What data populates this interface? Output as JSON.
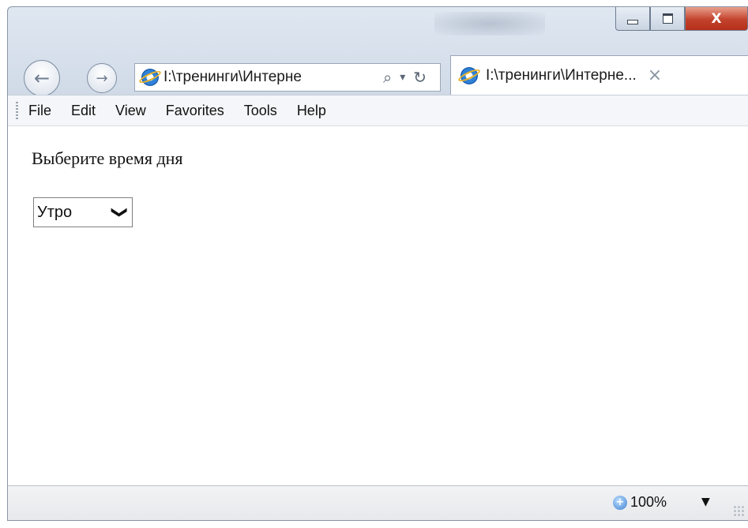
{
  "window": {
    "controls": [
      "minimize",
      "maximize",
      "close"
    ],
    "close_glyph": "X"
  },
  "navigation": {
    "back_icon": "←",
    "forward_icon": "→",
    "address": "I:\\тренинги\\Интерне",
    "search_icon": "⌕",
    "dropdown_icon": "▾",
    "refresh_icon": "↻"
  },
  "tab": {
    "title": "I:\\тренинги\\Интерне...",
    "close_icon": "×"
  },
  "menu": {
    "items": [
      "File",
      "Edit",
      "View",
      "Favorites",
      "Tools",
      "Help"
    ]
  },
  "page": {
    "prompt": "Выберите время дня",
    "select_value": "Утро",
    "select_chevron": "❯"
  },
  "status": {
    "zoom": "100%",
    "zoom_icon": "+",
    "zoom_dropdown": "▼"
  }
}
